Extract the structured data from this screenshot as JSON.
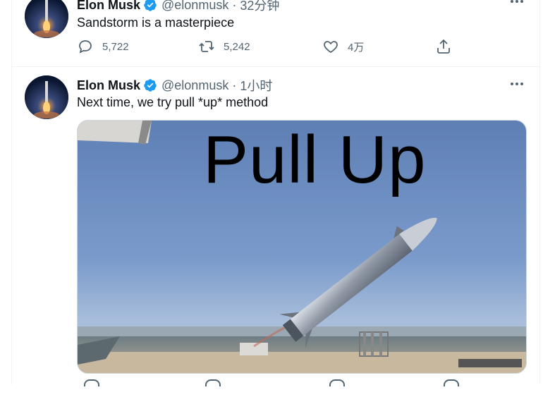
{
  "tweets": [
    {
      "author": "Elon Musk",
      "handle": "@elonmusk",
      "time": "32分钟",
      "text": "Sandstorm is a masterpiece",
      "replies": "5,722",
      "retweets": "5,242",
      "likes": "4万"
    },
    {
      "author": "Elon Musk",
      "handle": "@elonmusk",
      "time": "1小时",
      "text": "Next time, we try pull *up* method",
      "media_caption": "Pull Up"
    }
  ],
  "separator": "·",
  "colors": {
    "verified": "#1d9bf0",
    "secondary_text": "#536471",
    "border": "#eff3f4"
  }
}
